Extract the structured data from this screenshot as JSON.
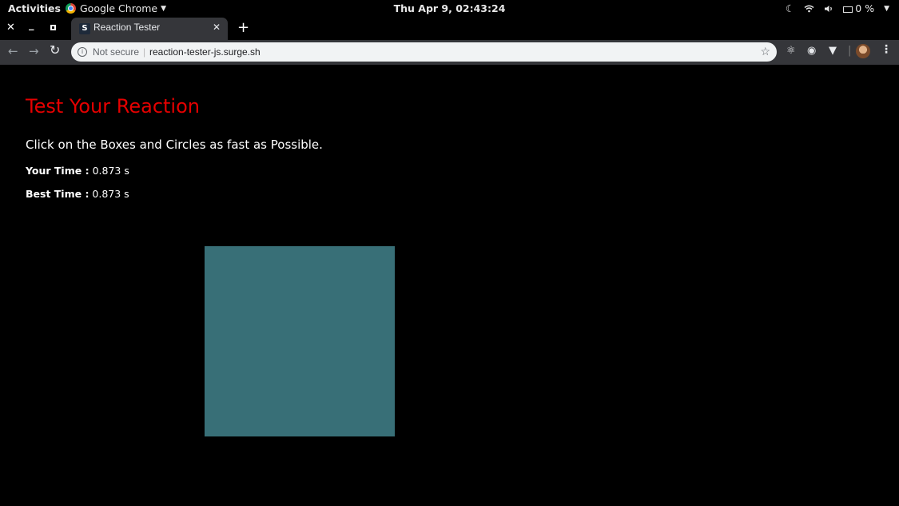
{
  "topbar": {
    "activities": "Activities",
    "app_name": "Google Chrome",
    "clock": "Thu Apr  9, 02:43:24",
    "battery": "0 %"
  },
  "browser": {
    "tab": {
      "favicon_letter": "S",
      "title": "Reaction Tester"
    },
    "omnibox": {
      "security_label": "Not secure",
      "url": "reaction-tester-js.surge.sh"
    }
  },
  "page": {
    "title": "Test Your Reaction",
    "instructions": "Click on the Boxes and Circles as fast as Possible.",
    "your_time_label": "Your Time :",
    "your_time_value": "0.873 s",
    "best_time_label": "Best Time :",
    "best_time_value": "0.873 s",
    "target": {
      "shape": "box",
      "color": "#386f77"
    },
    "colors": {
      "title": "#e50000",
      "background": "#000000",
      "text": "#ffffff"
    }
  }
}
